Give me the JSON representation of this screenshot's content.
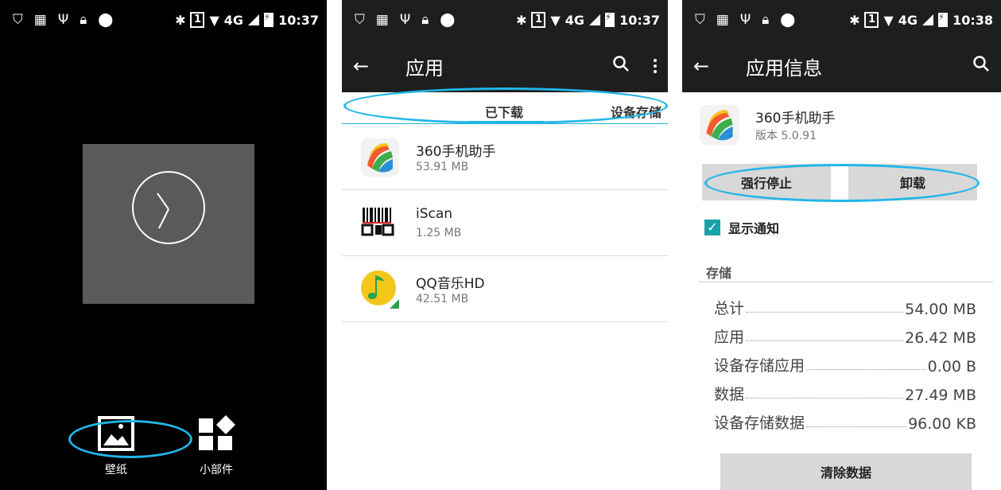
{
  "status": {
    "panel1_time": "10:37",
    "panel2_time": "10:37",
    "panel3_time": "10:38",
    "sim": "1",
    "network": "4G"
  },
  "panel1": {
    "wallpaper_label": "壁纸",
    "widgets_label": "小部件"
  },
  "panel2": {
    "title": "应用",
    "tabs": [
      "已下载",
      "设备存储"
    ],
    "apps": [
      {
        "name": "360手机助手",
        "size": "53.91 MB"
      },
      {
        "name": "iScan",
        "size": "1.25 MB"
      },
      {
        "name": "QQ音乐HD",
        "size": "42.51 MB"
      }
    ]
  },
  "panel3": {
    "title": "应用信息",
    "app_name": "360手机助手",
    "version": "版本 5.0.91",
    "force_stop": "强行停止",
    "uninstall": "卸载",
    "show_notify": "显示通知",
    "storage_title": "存储",
    "storage": [
      {
        "k": "总计",
        "v": "54.00 MB"
      },
      {
        "k": "应用",
        "v": "26.42 MB"
      },
      {
        "k": "设备存储应用",
        "v": "0.00 B"
      },
      {
        "k": "数据",
        "v": "27.49 MB"
      },
      {
        "k": "设备存储数据",
        "v": "96.00 KB"
      }
    ],
    "clear_data": "清除数据"
  },
  "colors": {
    "accent": "#21b6e8",
    "checkbox": "#1aa0a8",
    "bar": "#1e1e1e"
  },
  "icons": [
    "shield-icon",
    "barcode-icon",
    "usb-icon",
    "lock-icon",
    "android-icon",
    "bluetooth-icon",
    "sim-icon",
    "wifi-icon",
    "signal-icon",
    "battery-icon",
    "back-arrow-icon",
    "search-icon",
    "more-vert-icon",
    "clock-icon",
    "wallpaper-icon",
    "widgets-icon",
    "checkbox-icon"
  ]
}
